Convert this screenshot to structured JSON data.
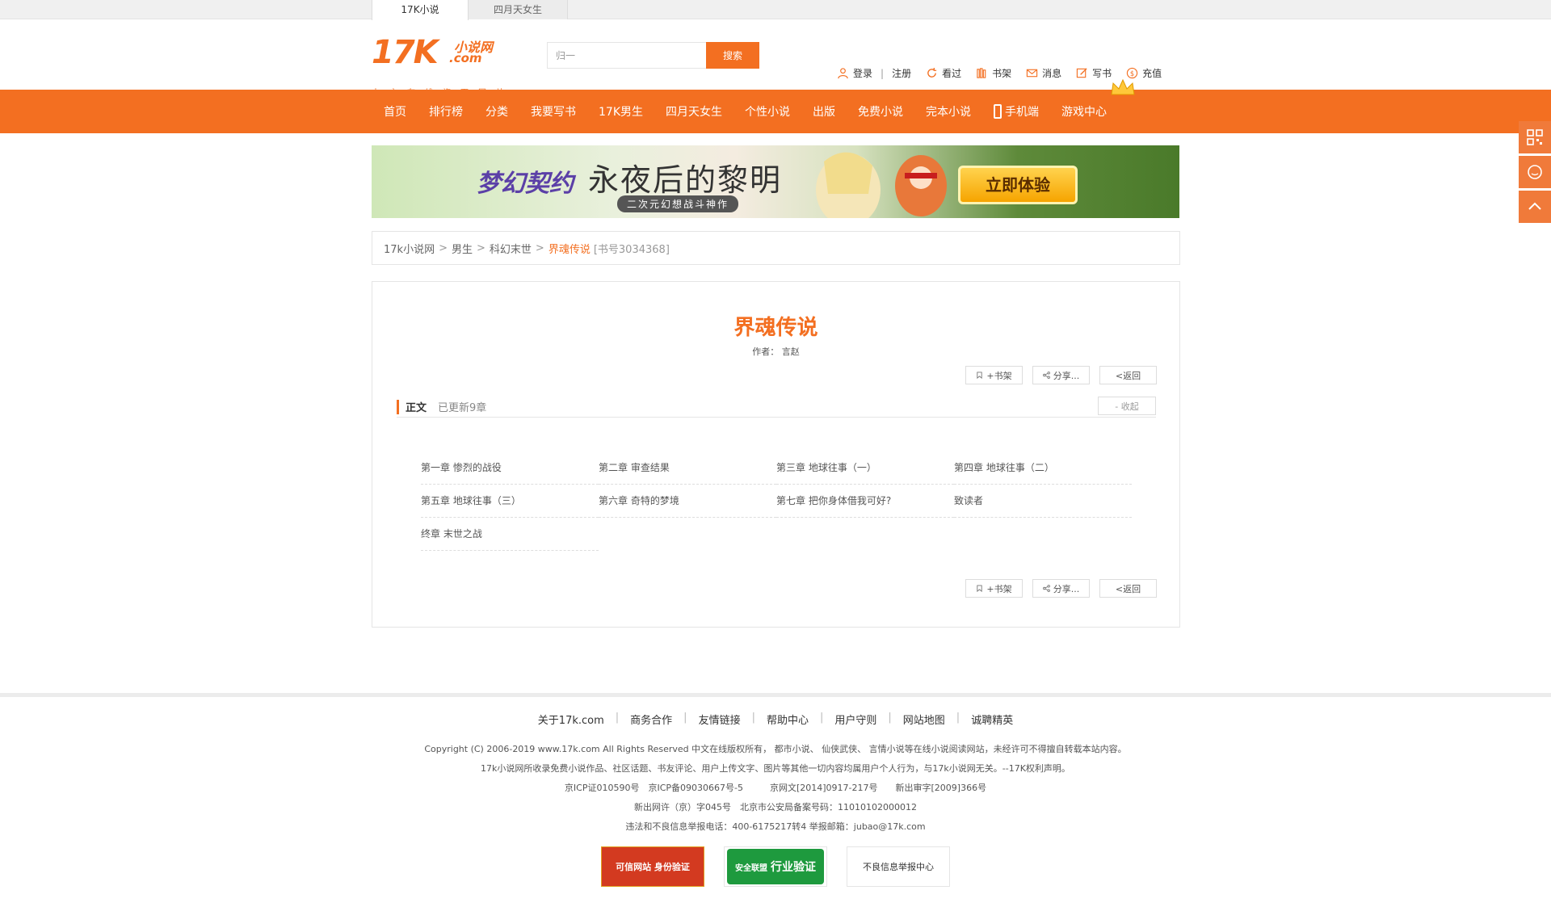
{
  "top_tabs": [
    "17K小说",
    "四月天女生"
  ],
  "logo": {
    "brand": "17K",
    "sub1": "小说网",
    "sub2": ".com",
    "slogan": "中文在线旗下网站"
  },
  "search": {
    "value": "归一",
    "button": "搜索"
  },
  "user_nav": {
    "login": "登录",
    "sep": "|",
    "register": "注册",
    "history": "看过",
    "shelf": "书架",
    "messages": "消息",
    "write": "写书",
    "recharge": "充值"
  },
  "main_nav": [
    "首页",
    "排行榜",
    "分类",
    "我要写书",
    "17K男生",
    "四月天女生",
    "个性小说",
    "出版",
    "免费小说",
    "完本小说",
    "手机端",
    "游戏中心"
  ],
  "banner": {
    "game_logo": "梦幻契约",
    "title": "永夜后的黎明",
    "subtitle": "二次元幻想战斗神作",
    "cta": "立即体验"
  },
  "breadcrumb": {
    "site": "17k小说网",
    "gt": ">",
    "cat1": "男生",
    "cat2": "科幻末世",
    "current": "界魂传说",
    "book_id": "[书号3034368]"
  },
  "book": {
    "title": "界魂传说",
    "author_label": "作者：",
    "author": "言赵",
    "btn_shelf": "+书架",
    "btn_share": "分享...",
    "btn_back": "<返回"
  },
  "volume": {
    "name": "正文",
    "count": "已更新9章",
    "collapse": "- 收起"
  },
  "chapters": [
    "第一章 惨烈的战役",
    "第二章 审查结果",
    "第三章 地球往事（一）",
    "第四章 地球往事（二）",
    "第五章 地球往事（三）",
    "第六章 奇特的梦境",
    "第七章 把你身体借我可好?",
    "致读者",
    "终章 末世之战"
  ],
  "side_tools": [
    "qrcode-icon",
    "service-icon",
    "back-to-top-icon"
  ],
  "footer": {
    "links": [
      "关于17k.com",
      "商务合作",
      "友情链接",
      "帮助中心",
      "用户守则",
      "网站地图",
      "诚聘精英"
    ],
    "lines": [
      "Copyright (C) 2006-2019 www.17k.com All Rights Reserved 中文在线版权所有， 都市小说、 仙侠武侠、 言情小说等在线小说阅读网站，未经许可不得擅自转载本站内容。",
      "17k小说网所收录免费小说作品、社区话题、书友评论、用户上传文字、图片等其他一切内容均属用户个人行为，与17k小说网无关。--17K权利声明。",
      "京ICP证010590号　京ICP备09030667号-5　　　京网文[2014]0917-217号　　新出审字[2009]366号",
      "新出网许（京）字045号　北京市公安局备案号码：11010102000012",
      "违法和不良信息举报电话：400-6175217转4 举报邮箱：jubao@17k.com"
    ],
    "badge1": "可信网站 身份验证",
    "badge2": "行业验证",
    "badge2_top": "安全联盟",
    "badge3": "不良信息举报中心"
  },
  "colors": {
    "accent": "#f36f21",
    "side_tool": "#f07a3a"
  }
}
